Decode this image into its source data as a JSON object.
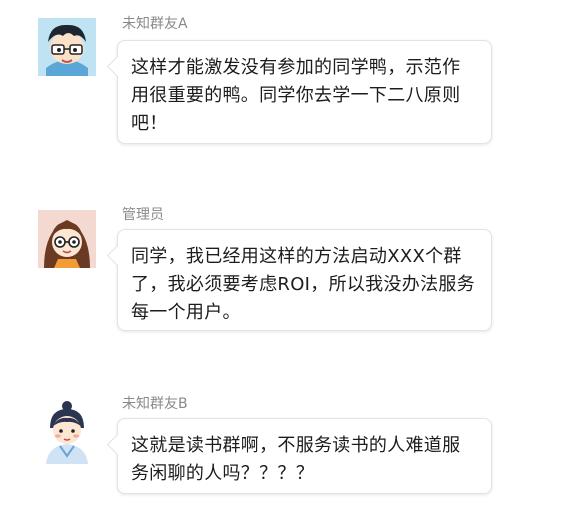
{
  "messages": [
    {
      "sender": "未知群友A",
      "avatar_icon": "boy-avatar-icon",
      "text": "这样才能激发没有参加的同学鸭，示范作用很重要的鸭。同学你去学一下二八原则吧！"
    },
    {
      "sender": "管理员",
      "avatar_icon": "girl-avatar-icon",
      "text": "同学，我已经用这样的方法启动XXX个群了，我必须要考虑ROI，所以我没办法服务每一个用户。"
    },
    {
      "sender": "未知群友B",
      "avatar_icon": "ancient-scholar-avatar-icon",
      "text": "这就是读书群啊，不服务读书的人难道服务闲聊的人吗？？？？"
    }
  ],
  "colors": {
    "name": "#8a8a8a",
    "bubble_border": "#e3e3e3",
    "text": "#1c1c1c"
  }
}
